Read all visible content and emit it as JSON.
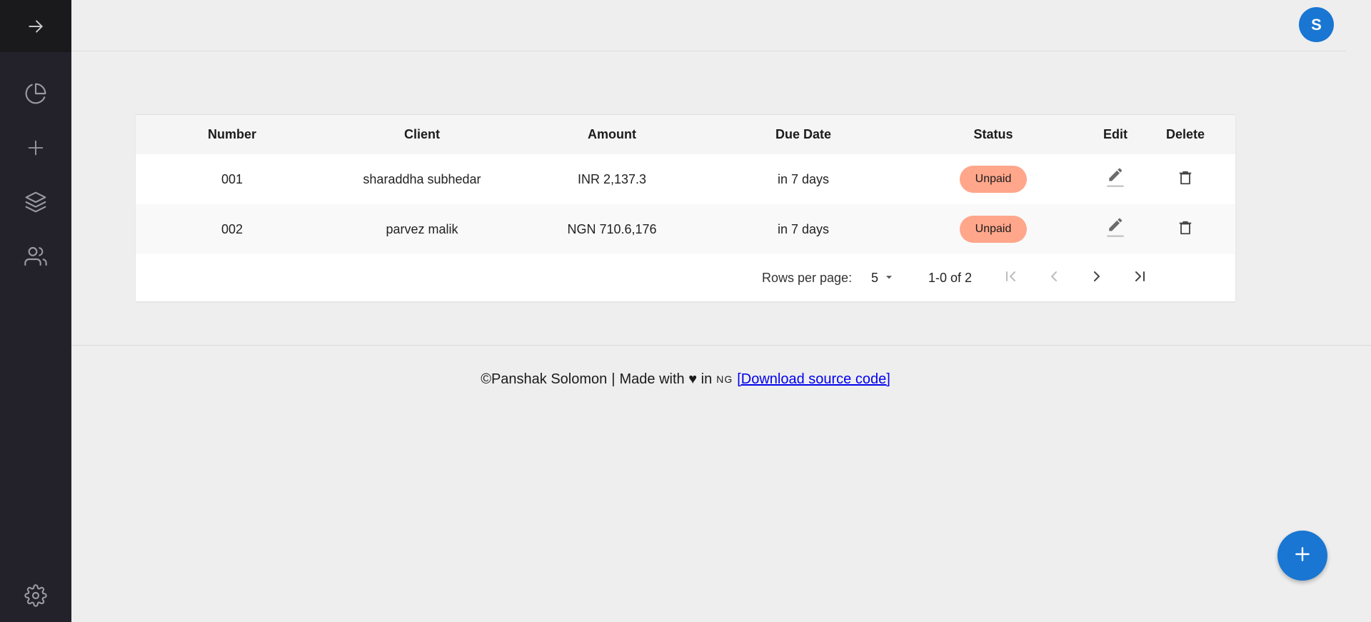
{
  "sidebar": {
    "toggle_icon": "arrow-right-icon",
    "items": [
      {
        "icon": "pie-chart-icon"
      },
      {
        "icon": "plus-icon"
      },
      {
        "icon": "layers-icon"
      },
      {
        "icon": "users-icon"
      }
    ],
    "settings_icon": "gear-icon"
  },
  "header": {
    "avatar_initial": "S",
    "avatar_color": "#1976d2"
  },
  "table": {
    "columns": [
      "Number",
      "Client",
      "Amount",
      "Due Date",
      "Status",
      "Edit",
      "Delete"
    ],
    "rows": [
      {
        "number": "001",
        "client": "sharaddha subhedar",
        "amount": "INR 2,137.3",
        "due": "in 7 days",
        "status": "Unpaid"
      },
      {
        "number": "002",
        "client": "parvez malik",
        "amount": "NGN 710.6,176",
        "due": "in 7 days",
        "status": "Unpaid"
      }
    ],
    "status_color": "#ffa68b"
  },
  "pagination": {
    "rows_per_page_label": "Rows per page:",
    "rows_per_page_value": "5",
    "range": "1-0 of 2"
  },
  "footer": {
    "copyright": "©Panshak Solomon",
    "separator": "|",
    "made_with": "Made with ♥ in",
    "country": "NG",
    "link_text": "[Download source code]"
  },
  "fab": {
    "icon": "plus-icon",
    "color": "#1976d2"
  }
}
